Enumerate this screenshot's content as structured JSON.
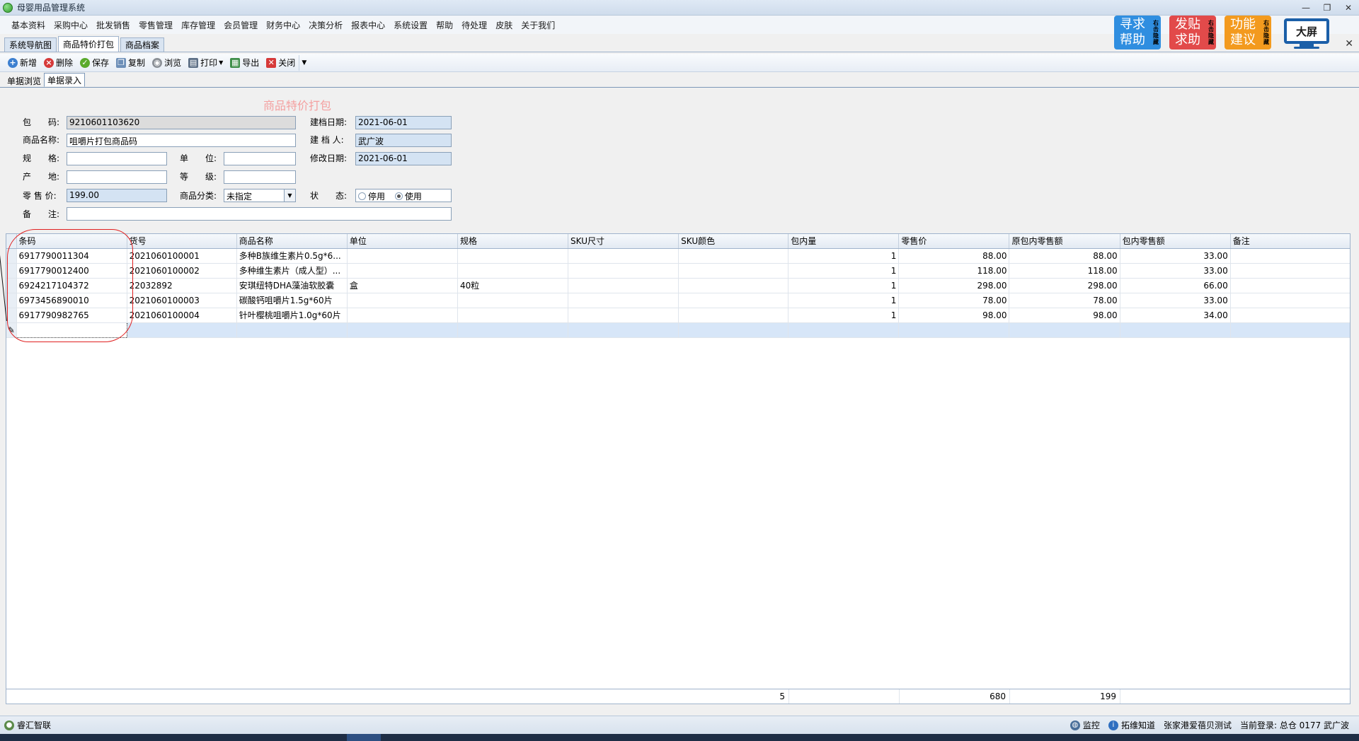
{
  "window": {
    "title": "母婴用品管理系统",
    "controls": [
      "—",
      "❐",
      "✕"
    ]
  },
  "menu": [
    "基本资料",
    "采购中心",
    "批发销售",
    "零售管理",
    "库存管理",
    "会员管理",
    "财务中心",
    "决策分析",
    "报表中心",
    "系统设置",
    "帮助",
    "待处理",
    "皮肤",
    "关于我们"
  ],
  "doc_tabs": [
    "系统导航图",
    "商品特价打包",
    "商品档案"
  ],
  "help_buttons": [
    {
      "text1": "寻求",
      "text2": "帮助",
      "side": [
        "右",
        "击",
        "隐",
        "藏"
      ],
      "color": "#2f8ee0"
    },
    {
      "text1": "发贴",
      "text2": "求助",
      "side": [
        "右",
        "击",
        "隐",
        "藏"
      ],
      "color": "#e24a4a"
    },
    {
      "text1": "功能",
      "text2": "建议",
      "side": [
        "右",
        "击",
        "隐",
        "藏"
      ],
      "color": "#f39a1e"
    }
  ],
  "screen_button": "大屏",
  "toolbar": {
    "new": "新增",
    "delete": "删除",
    "save": "保存",
    "copy": "复制",
    "browse": "浏览",
    "print": "打印",
    "export": "导出",
    "close": "关闭"
  },
  "sub_tabs": [
    "单据浏览",
    "单据录入"
  ],
  "form": {
    "title": "商品特价打包",
    "pack_code_label": "包　　码:",
    "pack_code": "9210601103620",
    "name_label": "商品名称:",
    "name": "咀嚼片打包商品码",
    "spec_label": "规　　格:",
    "spec": "",
    "unit_label": "单　　位:",
    "unit": "",
    "origin_label": "产　　地:",
    "origin": "",
    "grade_label": "等　　级:",
    "grade": "",
    "price_label": "零 售 价:",
    "price": "199.00",
    "category_label": "商品分类:",
    "category": "未指定",
    "remark_label": "备　　注:",
    "remark": "",
    "create_date_label": "建档日期:",
    "create_date": "2021-06-01",
    "creator_label": "建 档 人:",
    "creator": "武广波",
    "modify_date_label": "修改日期:",
    "modify_date": "2021-06-01",
    "status_label": "状　　态:",
    "status_options": [
      "停用",
      "使用"
    ],
    "status_selected": "使用"
  },
  "grid": {
    "columns": [
      "条码",
      "货号",
      "商品名称",
      "单位",
      "规格",
      "SKU尺寸",
      "SKU颜色",
      "包内量",
      "零售价",
      "原包内零售额",
      "包内零售额",
      "备注"
    ],
    "rows": [
      [
        "6917790011304",
        "2021060100001",
        "多种B族维生素片0.5g*6...",
        "",
        "",
        "",
        "",
        "1",
        "88.00",
        "88.00",
        "33.00",
        ""
      ],
      [
        "6917790012400",
        "2021060100002",
        "多种维生素片（成人型）...",
        "",
        "",
        "",
        "",
        "1",
        "118.00",
        "118.00",
        "33.00",
        ""
      ],
      [
        "6924217104372",
        "22032892",
        "安琪纽特DHA藻油软胶囊",
        "盒",
        "40粒",
        "",
        "",
        "1",
        "298.00",
        "298.00",
        "66.00",
        ""
      ],
      [
        "6973456890010",
        "2021060100003",
        "碳酸钙咀嚼片1.5g*60片",
        "",
        "",
        "",
        "",
        "1",
        "78.00",
        "78.00",
        "33.00",
        ""
      ],
      [
        "6917790982765",
        "2021060100004",
        "针叶樱桃咀嚼片1.0g*60片",
        "",
        "",
        "",
        "",
        "1",
        "98.00",
        "98.00",
        "34.00",
        ""
      ]
    ],
    "totals": {
      "qty": "5",
      "orig_amount": "680",
      "pack_amount": "199"
    },
    "new_row_marker": "✎"
  },
  "status": {
    "company": "睿汇智联",
    "monitor": "监控",
    "know": "拓维知道",
    "tenant": "张家港爱蓓贝测试",
    "login": "当前登录: 总仓 0177 武广波"
  }
}
